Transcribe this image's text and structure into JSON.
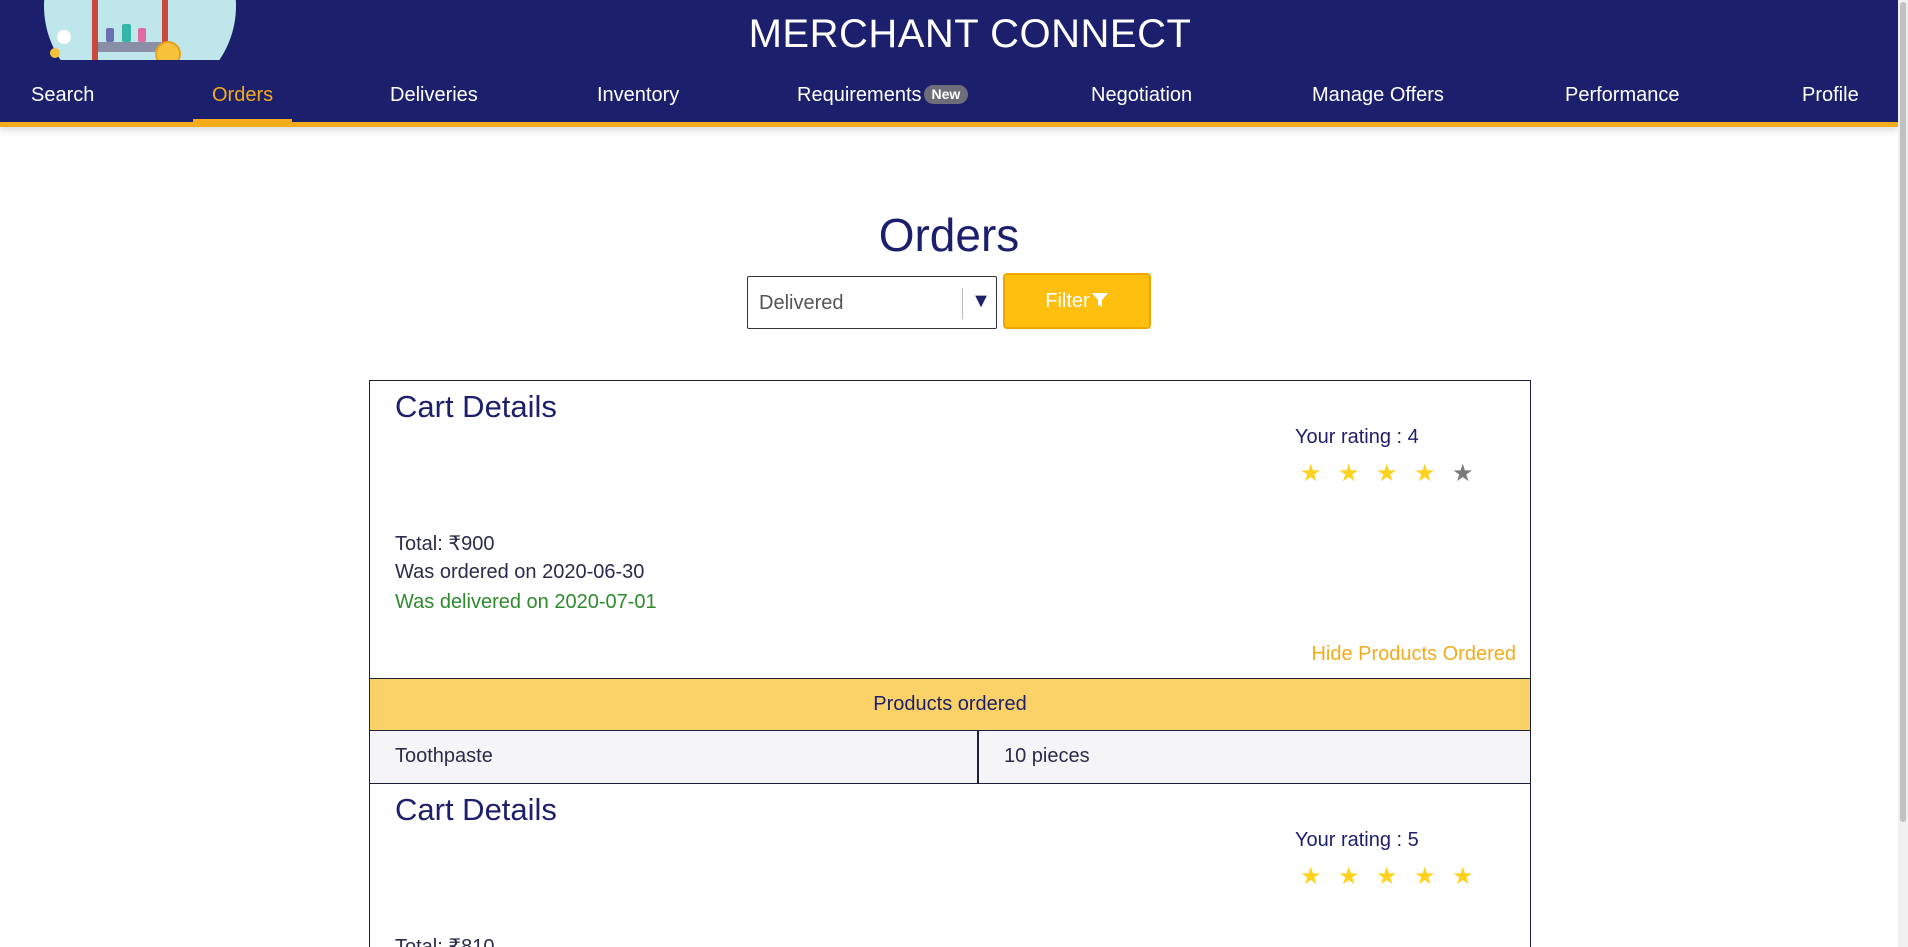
{
  "header": {
    "app_title": "MERCHANT CONNECT",
    "nav": [
      {
        "label": "Search",
        "active": false
      },
      {
        "label": "Orders",
        "active": true
      },
      {
        "label": "Deliveries",
        "active": false
      },
      {
        "label": "Inventory",
        "active": false
      },
      {
        "label": "Requirements",
        "badge": "New",
        "active": false
      },
      {
        "label": "Negotiation",
        "active": false
      },
      {
        "label": "Manage Offers",
        "active": false
      },
      {
        "label": "Performance",
        "active": false
      },
      {
        "label": "Profile",
        "active": false
      }
    ]
  },
  "page": {
    "title": "Orders",
    "filter": {
      "selected": "Delivered",
      "button_label": "Filter",
      "button_icon": "funnel-icon"
    }
  },
  "orders": [
    {
      "title": "Cart Details",
      "rating_label": "Your rating : 4",
      "rating": 4,
      "rating_max": 5,
      "total": "Total: ₹900",
      "ordered": "Was ordered on 2020-06-30",
      "delivered": "Was delivered on 2020-07-01",
      "toggle_label": "Hide Products Ordered",
      "products_header": "Products ordered",
      "products": [
        {
          "name": "Toothpaste",
          "quantity": "10 pieces"
        }
      ]
    },
    {
      "title": "Cart Details",
      "rating_label": "Your rating : 5",
      "rating": 5,
      "rating_max": 5,
      "total": "Total: ₹810"
    }
  ],
  "colors": {
    "navy": "#1c1f6b",
    "accent": "#f2ac1c",
    "star_on": "#ffd21f",
    "star_off": "#7b7b7b",
    "delivered_green": "#2e8b2e"
  }
}
